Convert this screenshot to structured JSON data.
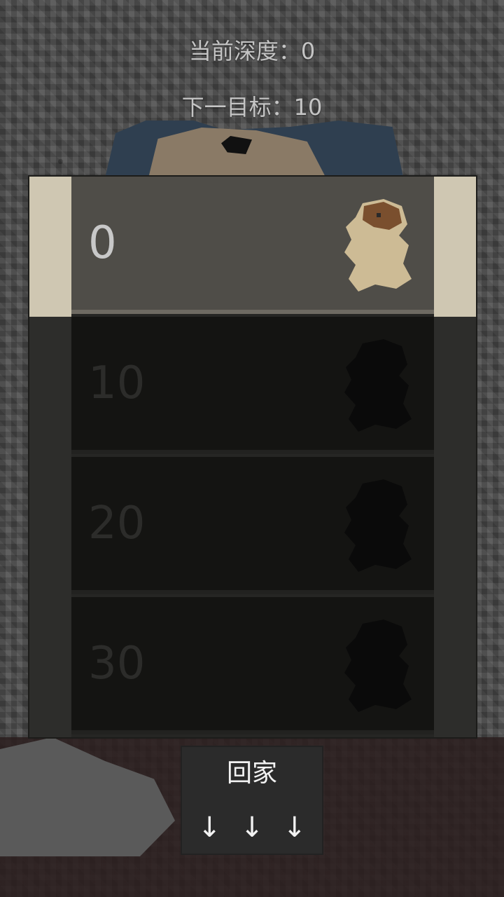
{
  "stats": {
    "depth_text": "当前深度：0",
    "target_text": "下一目标：10"
  },
  "levels": [
    {
      "depth": "0",
      "state": "current",
      "icon": "dragon-icon"
    },
    {
      "depth": "10",
      "state": "locked",
      "icon": "dragon-icon"
    },
    {
      "depth": "20",
      "state": "locked",
      "icon": "dragon-icon"
    },
    {
      "depth": "30",
      "state": "locked",
      "icon": "dragon-icon"
    }
  ],
  "nav": {
    "home_label": "回家",
    "down_label": "↓",
    "down_arrows": [
      "↓",
      "↓",
      "↓"
    ]
  },
  "colors": {
    "current_row": "#4f4d48",
    "current_frame": "#cfc7b2",
    "locked_row": "#141412",
    "icon_active": "#cdbb95"
  }
}
